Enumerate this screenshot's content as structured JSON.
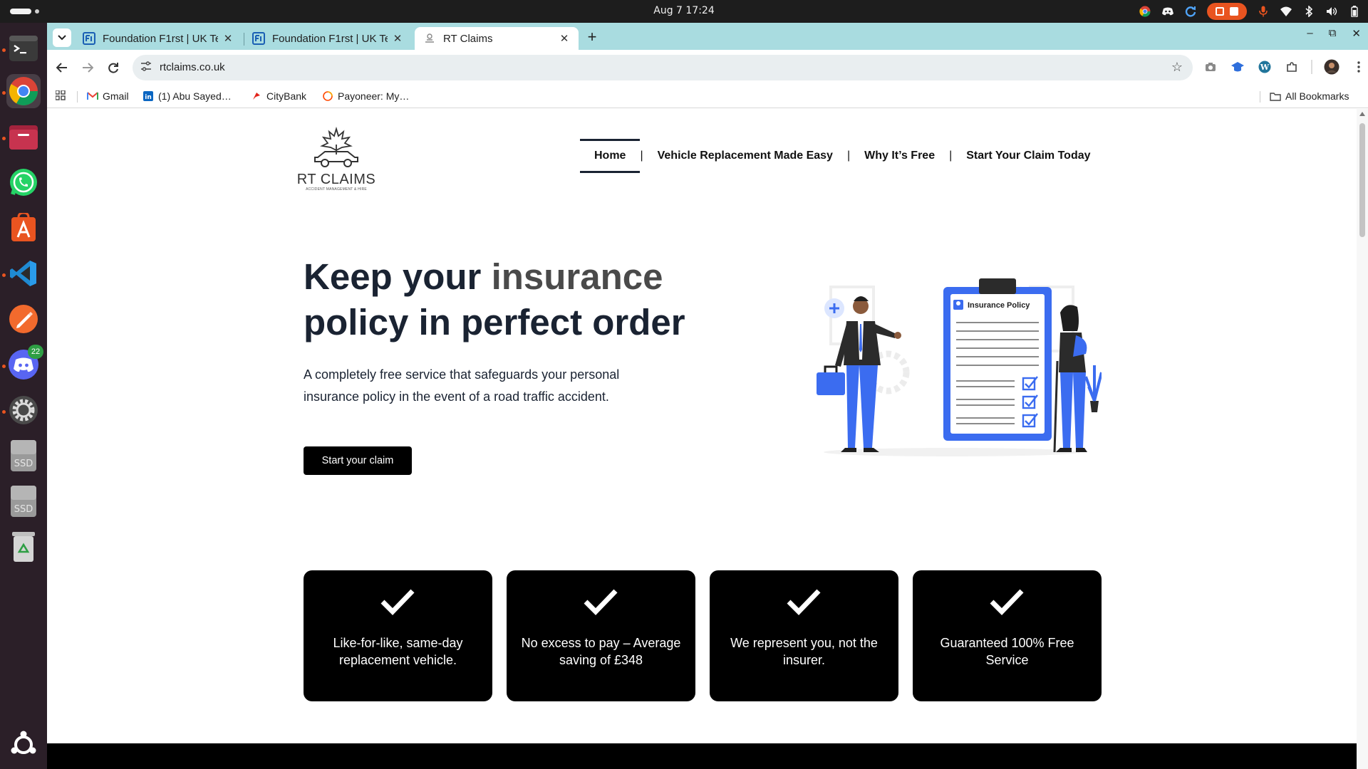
{
  "system": {
    "clock": "Aug 7  17:24"
  },
  "dock": {
    "discord_badge": "22",
    "ssd_label_1": "SSD",
    "ssd_label_2": "SSD"
  },
  "browser": {
    "tabs": [
      {
        "title": "Foundation F1rst | UK Te",
        "active": false
      },
      {
        "title": "Foundation F1rst | UK Te",
        "active": false
      },
      {
        "title": "RT Claims",
        "active": true
      }
    ],
    "url": "rtclaims.co.uk",
    "bookmarks": [
      {
        "label": "Gmail",
        "icon": "gmail-icon"
      },
      {
        "label": "(1) Abu Sayed…",
        "icon": "linkedin-icon"
      },
      {
        "label": "CityBank",
        "icon": "citybank-icon"
      },
      {
        "label": "Payoneer: My…",
        "icon": "payoneer-icon"
      }
    ],
    "all_bookmarks": "All Bookmarks"
  },
  "site": {
    "brand": "RT CLAIMS",
    "brand_tagline": "ACCIDENT MANAGEMENT & HIRE",
    "nav": [
      {
        "label": "Home",
        "active": true
      },
      {
        "label": "Vehicle Replacement Made Easy",
        "active": false
      },
      {
        "label": "Why It’s Free",
        "active": false
      },
      {
        "label": "Start Your Claim Today",
        "active": false
      }
    ],
    "nav_separator": "|",
    "hero": {
      "title_part1": "Keep your ",
      "title_accent": "insurance",
      "title_part2": " policy in perfect order",
      "text": "A completely free service that safeguards your personal insurance policy in the event of a road traffic accident.",
      "cta": "Start your claim",
      "illustration_heading": "Insurance Policy"
    },
    "features": [
      {
        "text": "Like-for-like, same-day replacement vehicle."
      },
      {
        "text": "No excess to pay – Average saving of £348"
      },
      {
        "text": "We represent you, not the insurer."
      },
      {
        "text": "Guaranteed 100% Free Service"
      }
    ]
  },
  "colors": {
    "tab_strip": "#a9dce0",
    "hero_title": "#1a2332",
    "hero_accent": "#4a4a4a",
    "illustration_blue": "#3b6cf0",
    "dock_bg": "#2b1f28"
  }
}
